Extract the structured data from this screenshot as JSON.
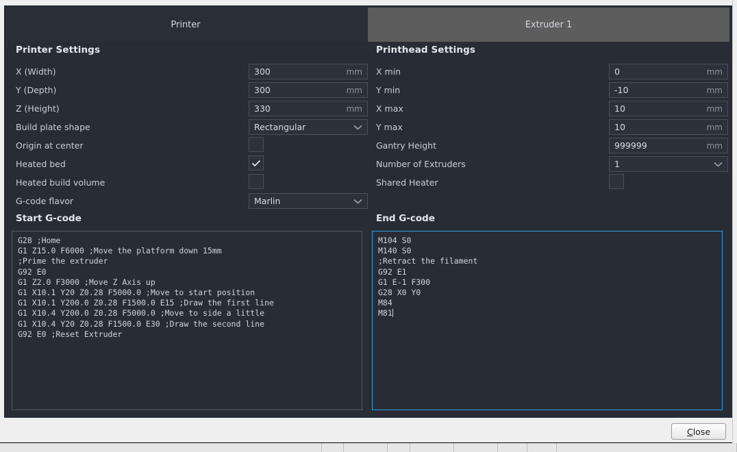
{
  "tabs": [
    {
      "label": "Printer",
      "active": true
    },
    {
      "label": "Extruder 1",
      "active": false
    }
  ],
  "printer_settings": {
    "title": "Printer Settings",
    "rows": [
      {
        "label": "X (Width)",
        "type": "text",
        "value": "300",
        "unit": "mm"
      },
      {
        "label": "Y (Depth)",
        "type": "text",
        "value": "300",
        "unit": "mm"
      },
      {
        "label": "Z (Height)",
        "type": "text",
        "value": "330",
        "unit": "mm"
      },
      {
        "label": "Build plate shape",
        "type": "dropdown",
        "value": "Rectangular",
        "unit": ""
      },
      {
        "label": "Origin at center",
        "type": "checkbox",
        "checked": false
      },
      {
        "label": "Heated bed",
        "type": "checkbox",
        "checked": true
      },
      {
        "label": "Heated build volume",
        "type": "checkbox",
        "checked": false
      },
      {
        "label": "G-code flavor",
        "type": "dropdown",
        "value": "Marlin",
        "unit": ""
      }
    ]
  },
  "printhead_settings": {
    "title": "Printhead Settings",
    "rows": [
      {
        "label": "X min",
        "type": "text",
        "value": "0",
        "unit": "mm"
      },
      {
        "label": "Y min",
        "type": "text",
        "value": "-10",
        "unit": "mm"
      },
      {
        "label": "X max",
        "type": "text",
        "value": "10",
        "unit": "mm"
      },
      {
        "label": "Y max",
        "type": "text",
        "value": "10",
        "unit": "mm"
      },
      {
        "label": "Gantry Height",
        "type": "text",
        "value": "999999",
        "unit": "mm"
      },
      {
        "label": "Number of Extruders",
        "type": "dropdown",
        "value": "1",
        "unit": ""
      },
      {
        "label": "Shared Heater",
        "type": "checkbox",
        "checked": false
      }
    ]
  },
  "start_gcode": {
    "title": "Start G-code",
    "focused": false,
    "text": "G28 ;Home\nG1 Z15.0 F6000 ;Move the platform down 15mm\n;Prime the extruder\nG92 E0\nG1 Z2.0 F3000 ;Move Z Axis up\nG1 X10.1 Y20 Z0.28 F5000.0 ;Move to start position\nG1 X10.1 Y200.0 Z0.28 F1500.0 E15 ;Draw the first line\nG1 X10.4 Y200.0 Z0.28 F5000.0 ;Move to side a little\nG1 X10.4 Y20 Z0.28 F1500.0 E30 ;Draw the second line\nG92 E0 ;Reset Extruder"
  },
  "end_gcode": {
    "title": "End G-code",
    "focused": true,
    "text": "M104 S0\nM140 S0\n;Retract the filament\nG92 E1\nG1 E-1 F300\nG28 X0 Y0\nM84\nM81"
  },
  "footer": {
    "close_label_prefix": "C",
    "close_label_rest": "lose"
  },
  "colors": {
    "dialog_bg": "#282d35",
    "tab_active": "#2a2f37",
    "tab_inactive": "#5d5d5d",
    "field_bg": "#2c313a",
    "field_border": "#4a5058",
    "focus_border": "#2ba3e0",
    "text": "#d9dee5",
    "muted_text": "#8b939d",
    "footer_bg": "#efeff0"
  },
  "icons": {
    "chevron_down": "chevron-down-icon",
    "check": "check-icon"
  }
}
